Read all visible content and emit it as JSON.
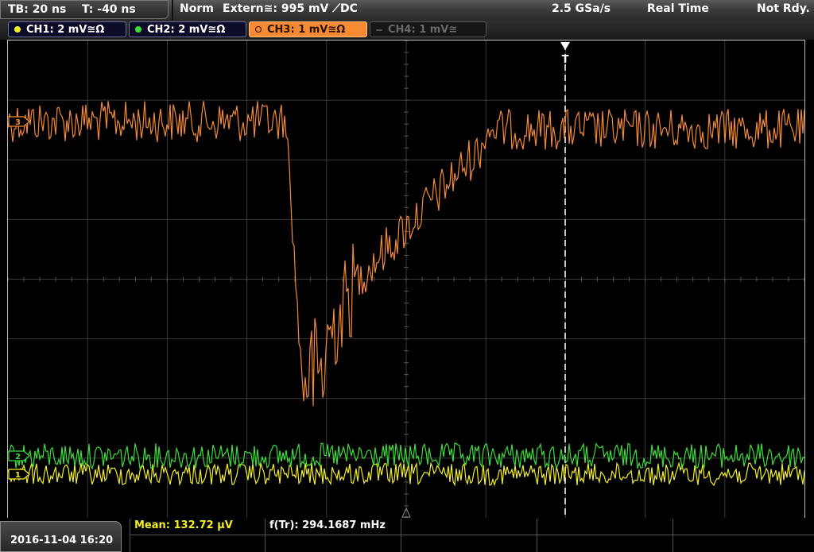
{
  "status": {
    "timebase": "TB: 20 ns",
    "trigger_time": "T: -40 ns",
    "trigger_mode": "Norm",
    "trigger_source": "Extern≅: 995 mV ⟋DC",
    "sample_rate": "2.5 GSa/s",
    "acquisition": "Real Time",
    "state": "Not Rdy."
  },
  "channels": [
    {
      "label": "CH1: 2 mV≅Ω",
      "color": "#f4f020",
      "active": true
    },
    {
      "label": "CH2: 2 mV≅Ω",
      "color": "#3adf3a",
      "active": true
    },
    {
      "label": "CH3: 1 mV≅Ω",
      "color": "#f58a32",
      "active": true,
      "selected": true
    },
    {
      "label": "CH4: 1 mV≅",
      "color": "#6a6a6a",
      "active": false
    }
  ],
  "markers": {
    "ch3": "3",
    "ch2": "2",
    "ch1": "1",
    "trigger": "T"
  },
  "footer": {
    "datetime": "2016-11-04 16:20",
    "mean": "Mean: 132.72 µV",
    "freq": "f(Tr): 294.1687 mHz"
  },
  "colors": {
    "ch1": "#f4f020",
    "ch2": "#3adf3a",
    "ch3": "#f58a32",
    "grid": "#3a3a3a"
  }
}
